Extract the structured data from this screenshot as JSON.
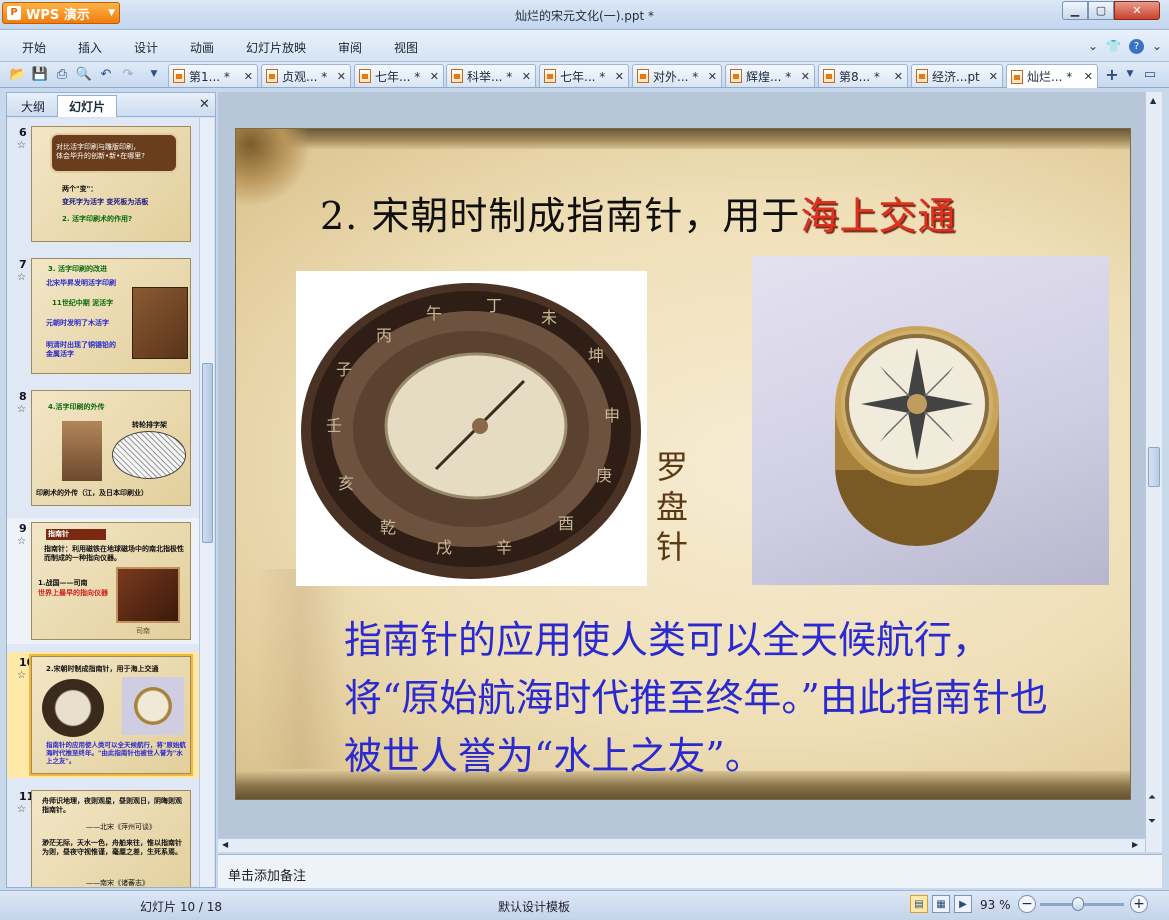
{
  "window": {
    "app_button": "WPS 演示",
    "title": "灿烂的宋元文化(一).ppt *"
  },
  "menu": [
    "开始",
    "插入",
    "设计",
    "动画",
    "幻灯片放映",
    "审阅",
    "视图"
  ],
  "tabs": [
    {
      "label": "第1... *",
      "active": false
    },
    {
      "label": "贞观... *",
      "active": false
    },
    {
      "label": "七年... *",
      "active": false
    },
    {
      "label": "科举... *",
      "active": false
    },
    {
      "label": "七年... *",
      "active": false
    },
    {
      "label": "对外... *",
      "active": false
    },
    {
      "label": "辉煌... *",
      "active": false
    },
    {
      "label": "第8... *",
      "active": false
    },
    {
      "label": "经济...pt",
      "active": false
    },
    {
      "label": "灿烂... *",
      "active": true
    }
  ],
  "left_panel": {
    "tabs": [
      "大纲",
      "幻灯片"
    ],
    "active_tab": "幻灯片",
    "slides": [
      {
        "num": "6",
        "lines": [
          "对比活字印刷与雕版印刷，",
          "体会毕升的创新•新•在哪里?",
          "两个\"变\"：",
          "变死字为活字 变死板为活板",
          "2. 活字印刷术的作用?"
        ]
      },
      {
        "num": "7",
        "lines": [
          "3. 活字印刷的改进",
          "北宋毕昇发明活字印刷",
          "11世纪中期 泥活字",
          "元朝时发明了木活字",
          "明清时出现了铜锡铅的金属活字"
        ]
      },
      {
        "num": "8",
        "lines": [
          "4.活字印刷的外传",
          "转轮排字架",
          "印刷术的外传（江，及日本印刷业）"
        ]
      },
      {
        "num": "9",
        "lines": [
          "指南针",
          "指南针：利用磁铁在地球磁场中的南北指极性而制成的一种指向仪器。",
          "1.战国——司南",
          "世界上最早的指向仪器",
          "司南"
        ]
      },
      {
        "num": "10",
        "lines": [
          "2.宋朝时制成指南针，用于海上交通",
          "指南针的应用使人类可以全天候航行，将\"原始航海时代推至终年。\"由此指南针也被世人誉为\"水上之友\"。"
        ]
      },
      {
        "num": "11",
        "lines": [
          "舟师识地理，夜则观星，昼则观日，阴晦则观指南针。",
          "——北宋《萍州可谈》",
          "渺茫无际，天水一色，舟舶来往，惟以指南针为则，昼夜守视惟谨，毫厘之差，生死系焉。",
          "——南宋《诸蕃志》"
        ]
      }
    ]
  },
  "slide": {
    "title_prefix": "2. 宋朝时制成指南针，用于",
    "title_highlight": "海上交通",
    "caption": "罗盘针",
    "body": "指南针的应用使人类可以全天候航行，将“原始航海时代推至终年。”由此指南针也被世人誉为“水上之友”。"
  },
  "notes_placeholder": "单击添加备注",
  "status": {
    "slide_position": "幻灯片 10 / 18",
    "template": "默认设计模板",
    "zoom": "93 %",
    "zoom_level_percent": 93
  },
  "colors": {
    "accent": "#f07d10",
    "title_highlight": "#e0301c",
    "body_text": "#2a2ad0"
  }
}
